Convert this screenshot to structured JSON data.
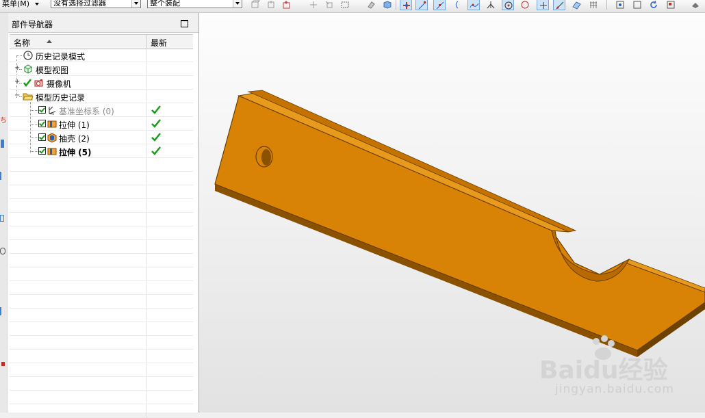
{
  "toolbar": {
    "menu_label": "菜单(M)",
    "filter_value": "没有选择过滤器",
    "scope_value": "整个装配",
    "icons": [
      "snap-icon",
      "point-icon",
      "line-icon",
      "arc-icon",
      "curve-icon",
      "end-point-icon",
      "mid-point-icon",
      "control-point-icon",
      "intersection-icon",
      "center-icon",
      "quadrant-icon",
      "existing-point-icon",
      "point-on-curve-icon",
      "fit-icon",
      "rotate-icon",
      "render-style-icon"
    ]
  },
  "navigator": {
    "title": "部件导航器",
    "col_name": "名称",
    "col_latest": "最新",
    "items": [
      {
        "label": "历史记录模式",
        "icon": "clock-icon",
        "level": 0,
        "latest": false
      },
      {
        "label": "模型视图",
        "icon": "model-view-icon",
        "level": 0,
        "expandable": true,
        "latest": false
      },
      {
        "label": "摄像机",
        "icon": "camera-icon",
        "level": 0,
        "expandable": true,
        "latest": false
      },
      {
        "label": "模型历史记录",
        "icon": "folder-open-icon",
        "level": 0,
        "expanded": true,
        "latest": false
      },
      {
        "label": "基准坐标系 (0)",
        "icon": "datum-csys-icon",
        "level": 1,
        "dim": true,
        "latest": true
      },
      {
        "label": "拉伸 (1)",
        "icon": "extrude-icon",
        "level": 1,
        "latest": true
      },
      {
        "label": "抽壳 (2)",
        "icon": "shell-icon",
        "level": 1,
        "latest": true
      },
      {
        "label": "拉伸 (5)",
        "icon": "extrude-icon",
        "level": 1,
        "bold": true,
        "latest": true
      }
    ]
  },
  "viewport": {
    "part_color": "#d88305",
    "watermark_text": "Baidu经验",
    "watermark_url": "jingyan.baidu.com"
  },
  "colors": {
    "check_green": "#1c9a1c",
    "active_button": "#cfe3f7"
  }
}
